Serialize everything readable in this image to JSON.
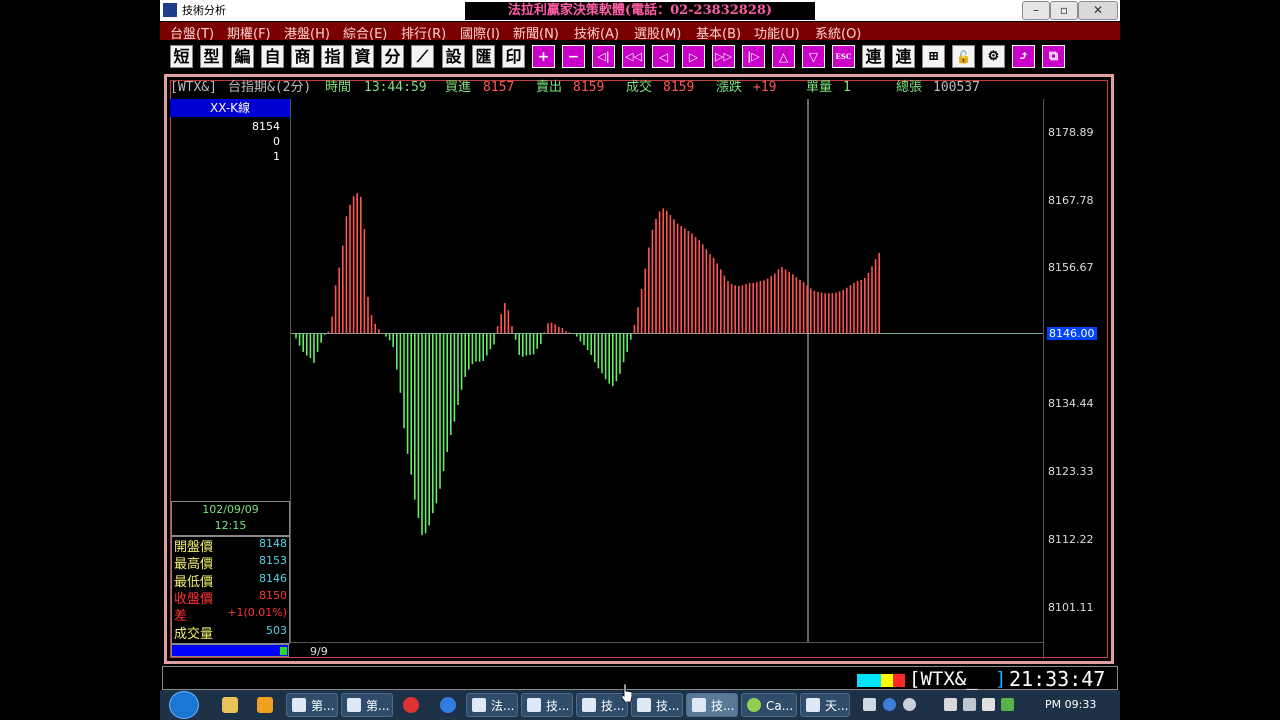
{
  "window": {
    "title": "技術分析",
    "banner": "法拉利贏家決策軟體(電話：02-23832828)",
    "controls": {
      "minimize": "–",
      "restore": "▫",
      "close": "✕"
    }
  },
  "menu": [
    "台盤(T)",
    "期權(F)",
    "港盤(H)",
    "綜合(E)",
    "排行(R)",
    "國際(I)",
    "新聞(N)",
    "技術(A)",
    "選股(M)",
    "基本(B)",
    "功能(U)",
    "系統(O)"
  ],
  "toolbar": [
    "短",
    "型",
    "編",
    "自",
    "商",
    "指",
    "資",
    "分",
    "⟋",
    "設",
    "匯",
    "印",
    "+",
    "−",
    "◁|",
    "◁◁",
    "◁",
    "▷",
    "▷▷",
    "|▷",
    "△",
    "▽",
    "ESC",
    "連",
    "連",
    "⊞",
    "🔓",
    "⚙",
    "⤴",
    "⧉"
  ],
  "quote": {
    "symbol": "[WTX&]",
    "name": "台指期&(2分)",
    "time_label": "時間",
    "time": "13:44:59",
    "bid_label": "買進",
    "bid": "8157",
    "ask_label": "賣出",
    "ask": "8159",
    "trade_label": "成交",
    "trade": "8159",
    "change_label": "漲跌",
    "change": "+19",
    "lot_label": "單量",
    "lot": "1",
    "total_label": "總張",
    "total": "100537"
  },
  "left_panel": {
    "header": "XX-K線",
    "values": [
      "8154",
      "0",
      "1"
    ],
    "date": "102/09/09",
    "time": "12:15",
    "ohlc": [
      {
        "label": "開盤價",
        "value": "8148",
        "color": "#f0f070"
      },
      {
        "label": "最高價",
        "value": "8153",
        "color": "#f0f070"
      },
      {
        "label": "最低價",
        "value": "8146",
        "color": "#f0f070"
      },
      {
        "label": "收盤價",
        "value": "8150",
        "color": "#ff3333"
      },
      {
        "label": "差",
        "value": "+1(0.01%)",
        "color": "#ff3333"
      },
      {
        "label": "成交量",
        "value": "503",
        "color": "#f0f070"
      }
    ]
  },
  "axis": {
    "ticks": [
      "8178.89",
      "8167.78",
      "8156.67",
      "8146.00",
      "8134.44",
      "8123.33",
      "8112.22",
      "8101.11"
    ],
    "highlight": "8146.00",
    "x_label": "9/9"
  },
  "chart_data": {
    "type": "bar",
    "baseline": 8146.0,
    "ylim": [
      8095.5,
      8184.4
    ],
    "colors": {
      "up": "#ff5555",
      "down": "#66ee66",
      "baseline": "#7fa8a8",
      "crosshair": "#cccccc"
    },
    "values": [
      8145.2,
      8144.0,
      8143.0,
      8142.4,
      8142.0,
      8141.2,
      8143.0,
      8144.5,
      8145.8,
      8146.3,
      8148.8,
      8153.9,
      8156.8,
      8160.4,
      8165.2,
      8167.1,
      8168.5,
      8169.0,
      8168.4,
      8163.1,
      8152.0,
      8149.0,
      8147.6,
      8146.7,
      8146.1,
      8145.5,
      8144.9,
      8143.8,
      8140.1,
      8136.3,
      8130.5,
      8126.3,
      8122.9,
      8118.8,
      8115.8,
      8113.0,
      8113.3,
      8114.6,
      8116.6,
      8118.2,
      8120.6,
      8123.5,
      8126.6,
      8129.4,
      8131.6,
      8134.3,
      8136.8,
      8138.9,
      8140.1,
      8141.0,
      8141.4,
      8141.4,
      8141.5,
      8142.4,
      8143.4,
      8144.2,
      8147.2,
      8149.2,
      8151.0,
      8149.8,
      8147.2,
      8145.0,
      8142.5,
      8142.2,
      8142.4,
      8142.5,
      8142.6,
      8143.5,
      8144.3,
      8146.2,
      8147.7,
      8147.8,
      8147.5,
      8147.1,
      8146.9,
      8146.4,
      8146.2,
      8145.9,
      8145.5,
      8144.7,
      8144.1,
      8143.3,
      8142.5,
      8141.3,
      8140.3,
      8139.5,
      8138.5,
      8137.8,
      8137.4,
      8138.2,
      8139.4,
      8141.3,
      8143.0,
      8145.0,
      8147.4,
      8150.3,
      8153.3,
      8156.6,
      8160.1,
      8163.0,
      8164.8,
      8166.0,
      8166.5,
      8166.1,
      8165.4,
      8164.7,
      8164.0,
      8163.6,
      8163.2,
      8162.8,
      8162.4,
      8161.8,
      8161.3,
      8160.6,
      8159.8,
      8159.0,
      8158.4,
      8157.5,
      8156.5,
      8155.5,
      8154.6,
      8154.1,
      8153.9,
      8153.8,
      8153.9,
      8154.1,
      8154.3,
      8154.3,
      8154.4,
      8154.6,
      8154.7,
      8155.0,
      8155.4,
      8155.8,
      8156.5,
      8156.9,
      8156.5,
      8156.1,
      8155.7,
      8155.2,
      8154.8,
      8154.4,
      8153.9,
      8153.4,
      8153.0,
      8152.8,
      8152.7,
      8152.6,
      8152.6,
      8152.6,
      8152.7,
      8152.9,
      8153.1,
      8153.5,
      8153.9,
      8154.3,
      8154.6,
      8154.8,
      8155.1,
      8155.9,
      8157.0,
      8158.2,
      8159.2
    ]
  },
  "status": {
    "symbol": "[WTX&_",
    "bracket": "]",
    "time": "21:33:47",
    "color_boxes": [
      "#00e5ff",
      "#00e5ff",
      "#ffff00",
      "#ff2a2a"
    ]
  },
  "taskbar": {
    "tasks": [
      {
        "label": "第...",
        "active": false
      },
      {
        "label": "第...",
        "active": false
      },
      {
        "label": "法...",
        "active": false
      },
      {
        "label": "技...",
        "active": false
      },
      {
        "label": "技...",
        "active": false
      },
      {
        "label": "技...",
        "active": false
      },
      {
        "label": "技...",
        "active": true
      },
      {
        "label": "Ca...",
        "active": false
      },
      {
        "label": "天...",
        "active": false
      }
    ],
    "clock": "PM 09:33"
  }
}
